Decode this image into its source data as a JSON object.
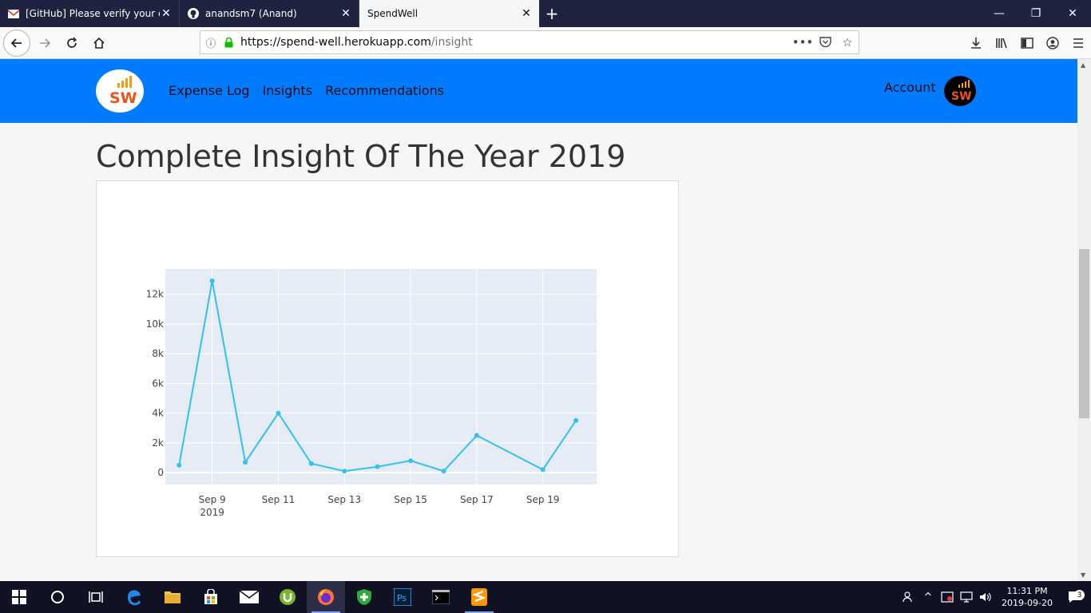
{
  "browser": {
    "tabs": [
      {
        "title": "[GitHub] Please verify your em",
        "icon": "gmail-icon",
        "active": false
      },
      {
        "title": "anandsm7 (Anand)",
        "icon": "github-icon",
        "active": false
      },
      {
        "title": "SpendWell",
        "icon": "",
        "active": true
      }
    ],
    "new_tab": "+",
    "url_host": "https://spend-well.herokuapp.com",
    "url_path": "/insight"
  },
  "site": {
    "brand": "SW",
    "nav": [
      "Expense Log",
      "Insights",
      "Recommendations"
    ],
    "account": "Account",
    "avatar": "SW"
  },
  "page": {
    "heading": "Complete Insight Of The Year 2019"
  },
  "chart_data": {
    "type": "line",
    "x": [
      "2019-09-08",
      "2019-09-09",
      "2019-09-10",
      "2019-09-11",
      "2019-09-12",
      "2019-09-13",
      "2019-09-14",
      "2019-09-15",
      "2019-09-16",
      "2019-09-17",
      "2019-09-19",
      "2019-09-20"
    ],
    "values": [
      500,
      12900,
      700,
      4000,
      600,
      100,
      400,
      800,
      100,
      2500,
      200,
      3500
    ],
    "xticks": [
      {
        "date": "2019-09-09",
        "label": "Sep 9",
        "sublabel": "2019"
      },
      {
        "date": "2019-09-11",
        "label": "Sep 11",
        "sublabel": ""
      },
      {
        "date": "2019-09-13",
        "label": "Sep 13",
        "sublabel": ""
      },
      {
        "date": "2019-09-15",
        "label": "Sep 15",
        "sublabel": ""
      },
      {
        "date": "2019-09-17",
        "label": "Sep 17",
        "sublabel": ""
      },
      {
        "date": "2019-09-19",
        "label": "Sep 19",
        "sublabel": ""
      }
    ],
    "yticks": [
      0,
      2000,
      4000,
      6000,
      8000,
      10000,
      12000
    ],
    "ytick_labels": [
      "0",
      "2k",
      "4k",
      "6k",
      "8k",
      "10k",
      "12k"
    ],
    "xlim": [
      "2019-09-07T14:00",
      "2019-09-20T15:00"
    ],
    "ylim": [
      -800,
      13700
    ],
    "grid": true,
    "line_color": "#33c1ef",
    "plot_bg": "#e5ecf6"
  },
  "taskbar": {
    "time": "11:31 PM",
    "date": "2019-09-20",
    "notifications": "3"
  },
  "colors": {
    "navbar": "#007bff",
    "tabbar": "#202340",
    "taskbar": "#101223"
  }
}
